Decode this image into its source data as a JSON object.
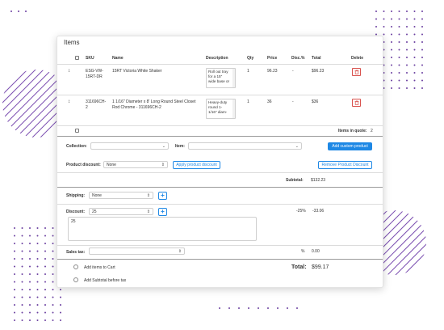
{
  "panel": {
    "title": "Items"
  },
  "table": {
    "headers": {
      "sku": "SKU",
      "name": "Name",
      "description": "Description",
      "qty": "Qty",
      "price": "Price",
      "disc": "Disc.%",
      "total": "Total",
      "delete": "Delete"
    },
    "rows": [
      {
        "sku": [
          "ESG-VW-",
          "15RT-DR"
        ],
        "name": [
          "15RT Victoria White Shaker"
        ],
        "description": [
          "Roll out tray",
          "for a 15\"",
          "wide base or"
        ],
        "qty": "1",
        "price": "96.23",
        "disc": "-",
        "total": "$96.23"
      },
      {
        "sku": [
          "311696CH-",
          "2"
        ],
        "name": [
          "1 1/16\" Diameter x 8' Long Round Steel Closet",
          "Rod Chrome - 311696CH-2"
        ],
        "description": [
          "Heavy-duty",
          "round 1-",
          "1/16\" diam-"
        ],
        "qty": "1",
        "price": "36",
        "disc": "-",
        "total": "$36"
      }
    ],
    "items_in_quote_label": "Items in quote:",
    "items_in_quote_value": "2"
  },
  "collection": {
    "label": "Collection:",
    "value": ""
  },
  "item": {
    "label": "Item:",
    "value": ""
  },
  "add_custom_product_label": "Add custom product",
  "product_discount": {
    "label": "Product discount:",
    "value": "None"
  },
  "apply_product_discount_label": "Apply product discount",
  "remove_product_discount_label": "Remove Product Discount",
  "subtotal": {
    "label": "Subtotal:",
    "value": "$132.23"
  },
  "shipping": {
    "label": "Shipping:",
    "value": "None"
  },
  "discount": {
    "label": "Discount:",
    "value": "25",
    "percent": "-25%",
    "amount": "-33.06",
    "note": "25"
  },
  "sales_tax": {
    "label": "Sales tax:",
    "value": "",
    "percent_sign": "%",
    "amount": "0.00"
  },
  "total": {
    "label": "Total:",
    "value": "$99.17"
  },
  "options": {
    "add_to_cart": "Add items to Cart",
    "add_subtotal": "Add Subtotal before tax"
  },
  "colors": {
    "accent": "#1e88e5",
    "danger": "#d9534f",
    "decoration": "#6b3fa0"
  }
}
